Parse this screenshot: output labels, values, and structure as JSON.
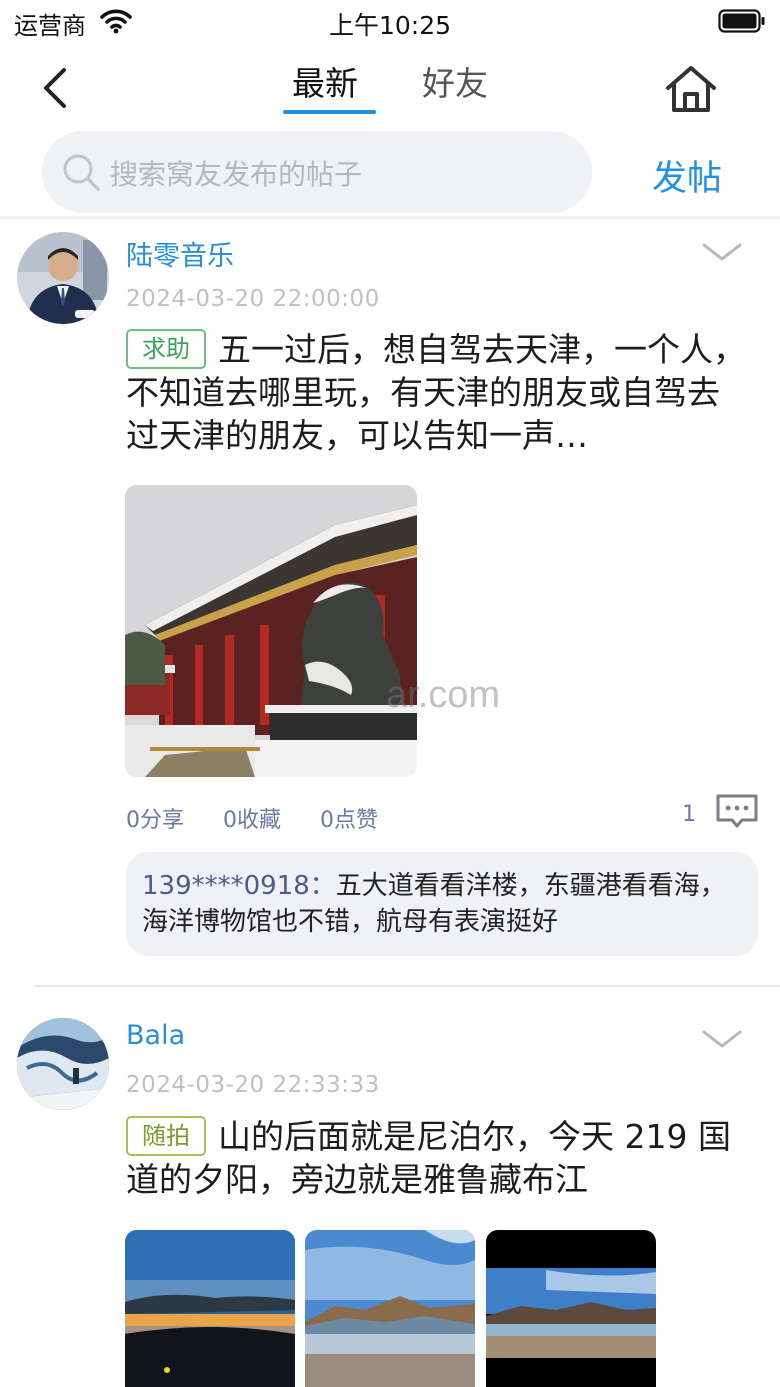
{
  "status_bar": {
    "carrier": "运营商",
    "time": "上午10:25"
  },
  "nav": {
    "tabs": [
      {
        "label": "最新",
        "active": true
      },
      {
        "label": "好友",
        "active": false
      }
    ],
    "accent_color": "#1e90e6"
  },
  "search": {
    "placeholder": "搜索窝友发布的帖子",
    "post_button": "发帖"
  },
  "posts": [
    {
      "username": "陆零音乐",
      "timestamp": "2024-03-20 22:00:00",
      "tag": "求助",
      "text": "五一过后，想自驾去天津，一个人，不知道去哪里玩，有天津的朋友或自驾去过天津的朋友，可以告知一声…",
      "images": [
        "snowy-palace-stone-lion"
      ],
      "actions": {
        "share": "0分享",
        "favorite": "0收藏",
        "like": "0点赞",
        "comments": "1"
      },
      "reply": {
        "user": "139****0918：",
        "text": "五大道看看洋楼，东疆港看看海，海洋博物馆也不错，航母有表演挺好"
      }
    },
    {
      "username": "Bala",
      "timestamp": "2024-03-20 22:33:33",
      "tag": "随拍",
      "text": "山的后面就是尼泊尔，今天 219 国道的夕阳，旁边就是雅鲁藏布江",
      "images": [
        "sunset-car-dashboard",
        "mountain-lake-blue-sky",
        "mountain-river-plain"
      ]
    }
  ],
  "watermark": "ar.com"
}
